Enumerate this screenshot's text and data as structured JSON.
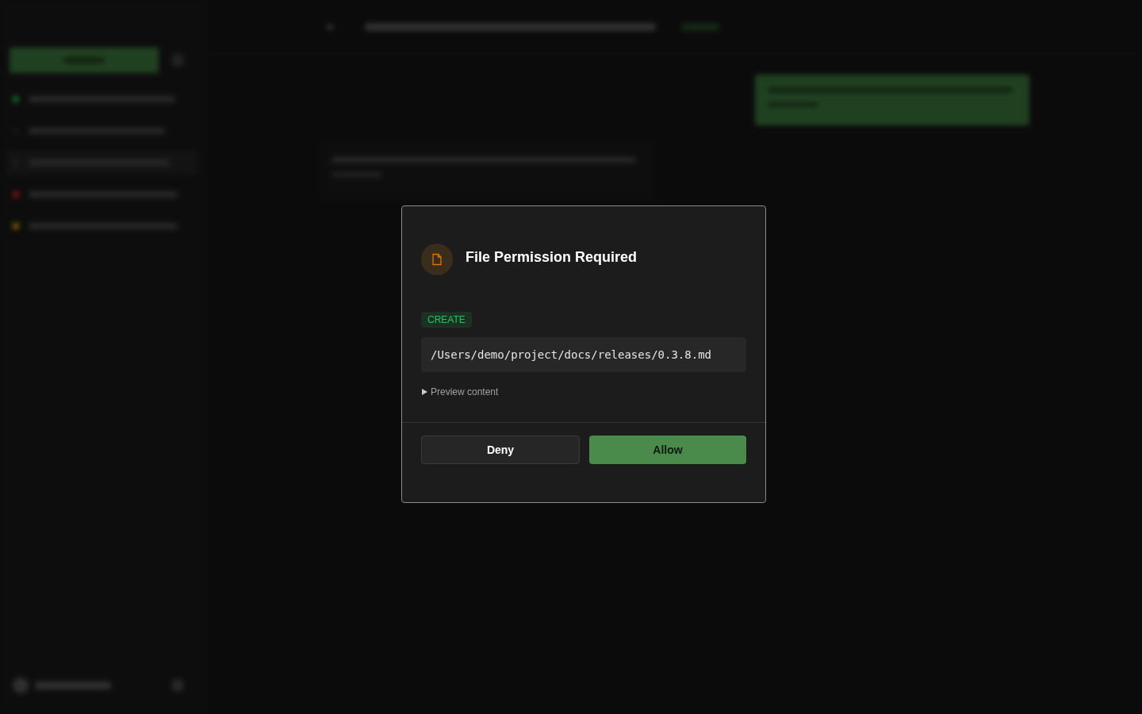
{
  "dialog": {
    "title": "File Permission Required",
    "operation": "CREATE",
    "path": "/Users/demo/project/docs/releases/0.3.8.md",
    "preview": {
      "label": "Preview content",
      "expanded": false
    },
    "buttons": [
      {
        "label": "Deny",
        "kind": "secondary"
      },
      {
        "label": "Allow",
        "kind": "primary"
      }
    ]
  }
}
